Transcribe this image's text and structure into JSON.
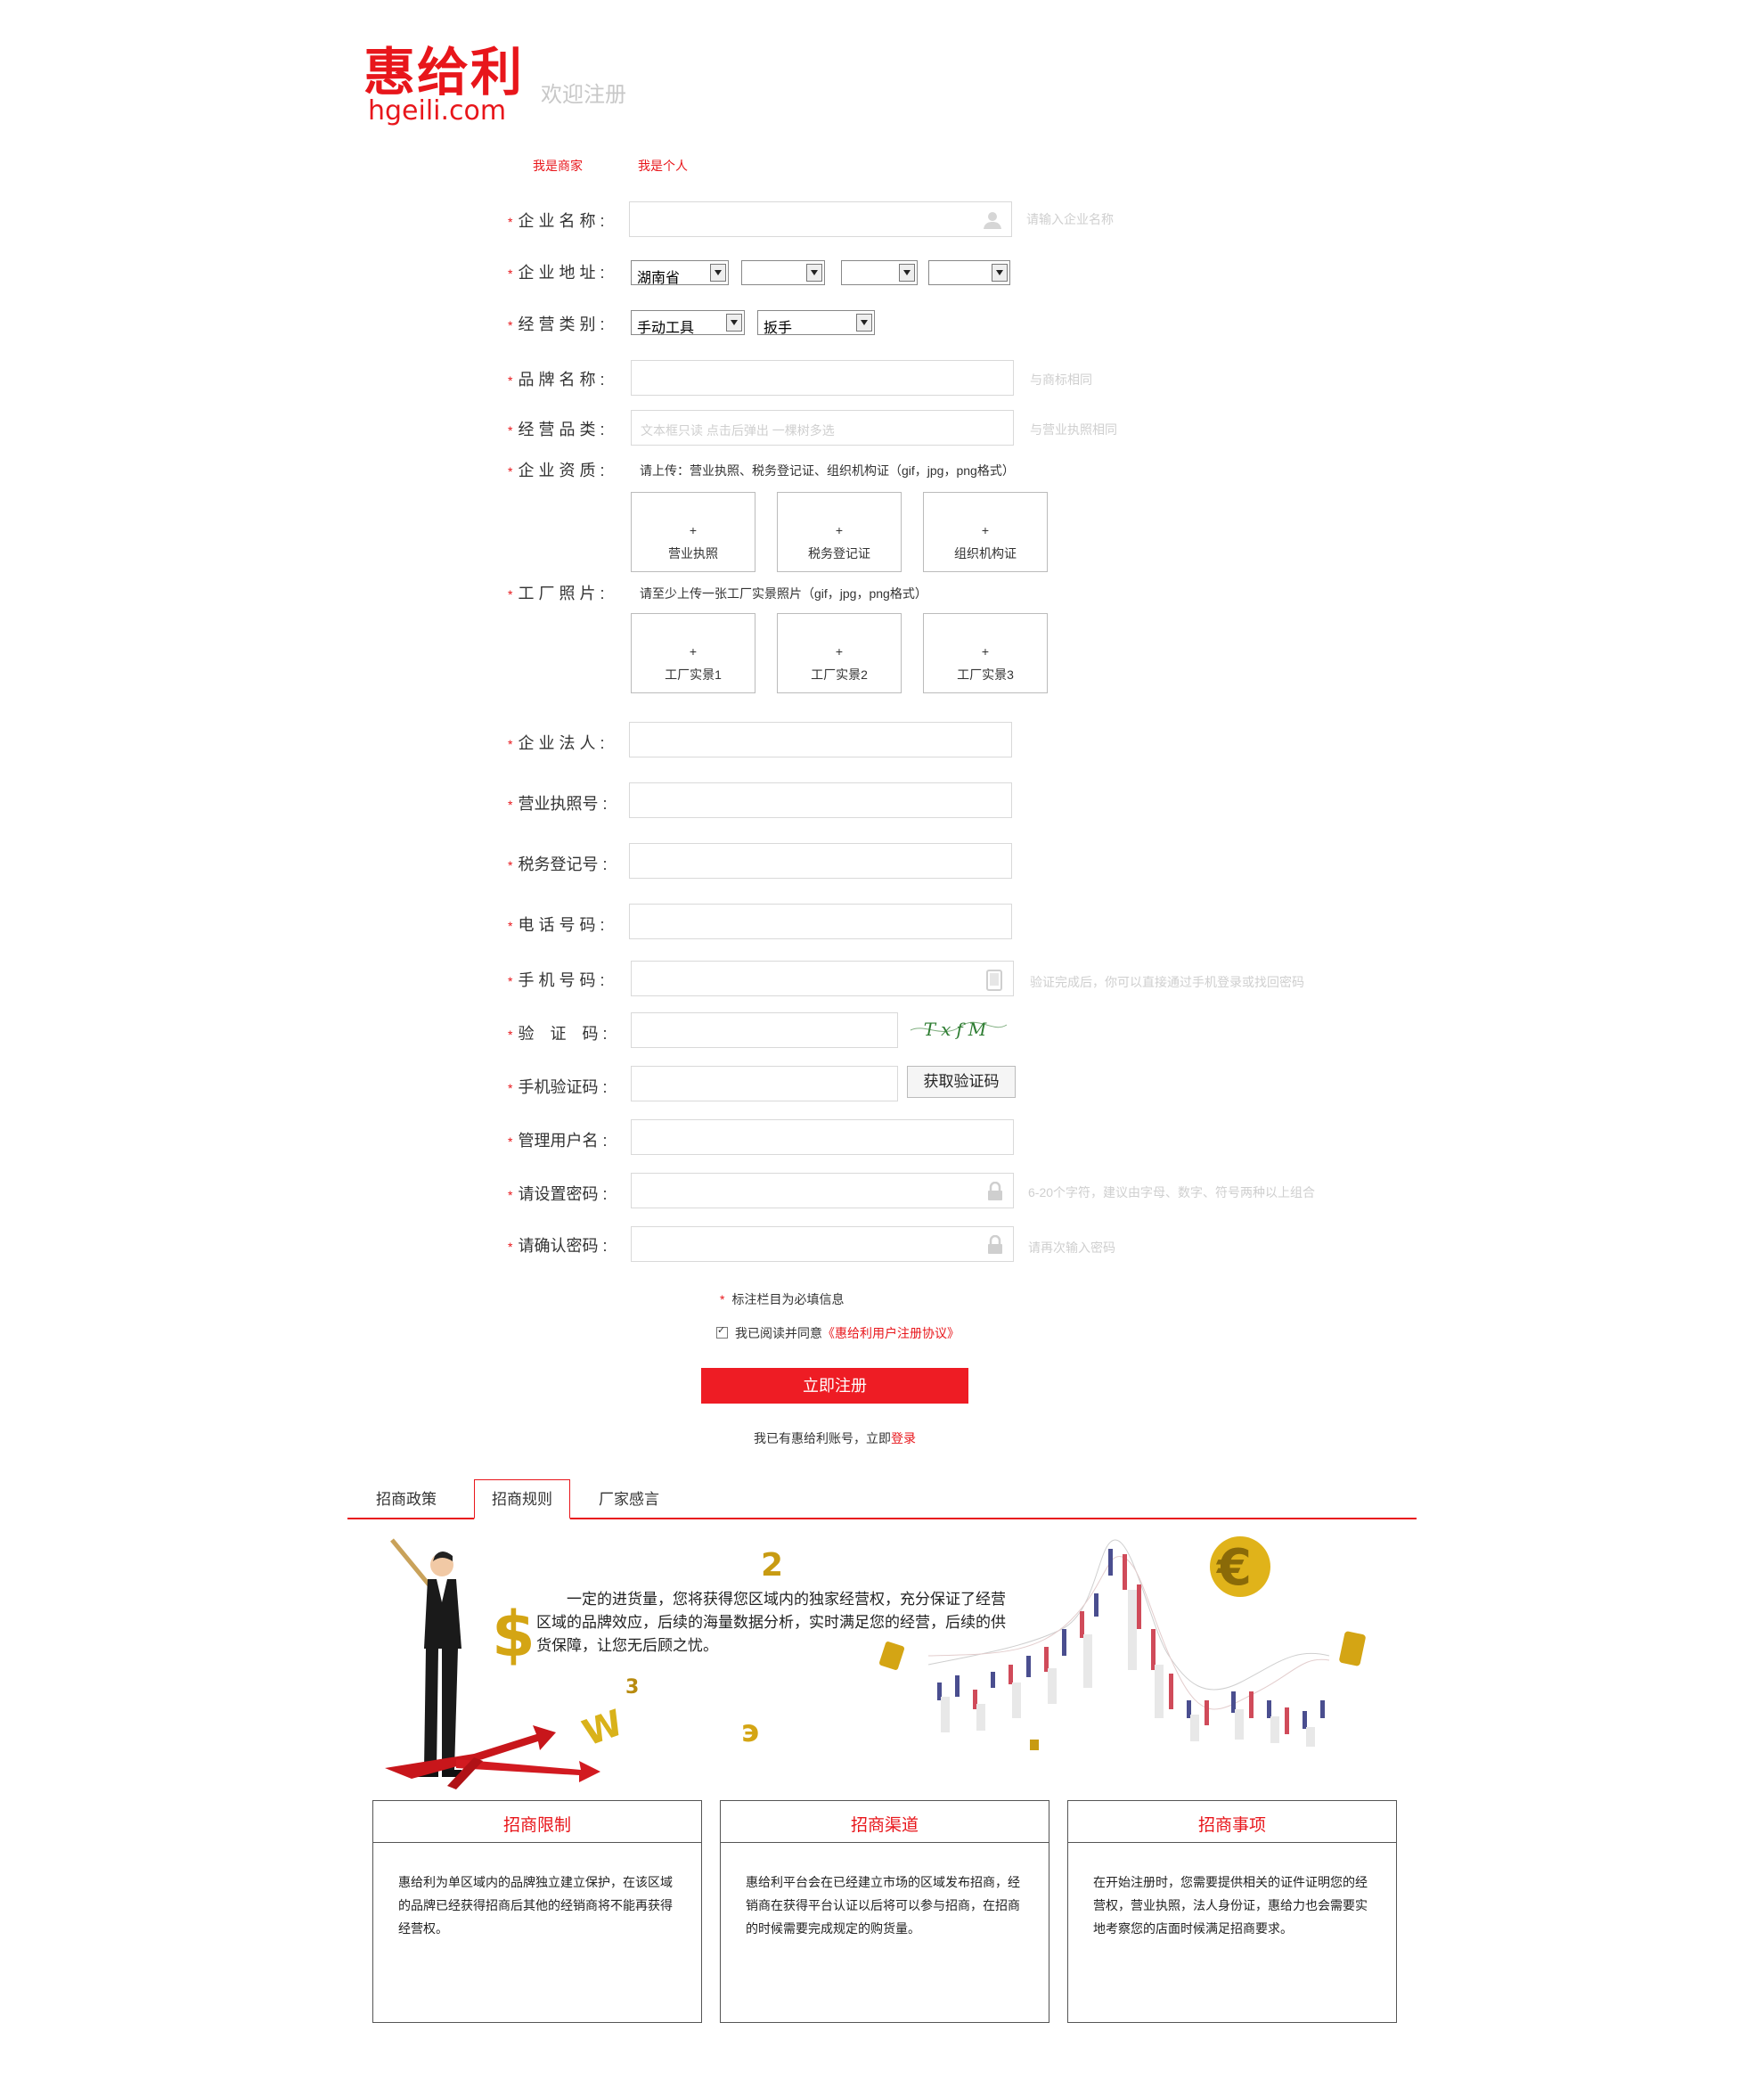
{
  "header": {
    "logo_cn": "惠给利",
    "logo_en": "hgeili.com",
    "welcome": "欢迎注册"
  },
  "reg_tabs": [
    "我是商家",
    "我是个人"
  ],
  "form": {
    "company_name": {
      "label": "企 业 名 称 :",
      "hint": "请输入企业名称"
    },
    "address": {
      "label": "企 业 地 址 :",
      "province": "湖南省",
      "city": "",
      "district": "",
      "street": ""
    },
    "category": {
      "label": "经 营 类 别 :",
      "main": "手动工具",
      "sub": "扳手"
    },
    "brand": {
      "label": "品 牌 名 称 :",
      "hint": "与商标相同"
    },
    "products": {
      "label": "经 营 品 类 :",
      "placeholder": "文本框只读 点击后弹出 一棵树多选",
      "hint": "与营业执照相同"
    },
    "qualification": {
      "label": "企 业 资 质 :",
      "note": "请上传：营业执照、税务登记证、组织机构证（gif，jpg，png格式）",
      "uploads": [
        "营业执照",
        "税务登记证",
        "组织机构证"
      ]
    },
    "factory": {
      "label": "工 厂 照 片 :",
      "note": "请至少上传一张工厂实景照片（gif，jpg，png格式）",
      "uploads": [
        "工厂实景1",
        "工厂实景2",
        "工厂实景3"
      ]
    },
    "upload_plus": "+",
    "legal_person": {
      "label": "企 业 法 人 :"
    },
    "license_no": {
      "label": "营业执照号 :"
    },
    "tax_no": {
      "label": "税务登记号 :"
    },
    "phone": {
      "label": "电 话 号 码 :"
    },
    "mobile": {
      "label": "手 机 号 码 :",
      "hint": "验证完成后，你可以直接通过手机登录或找回密码"
    },
    "captcha": {
      "label": "验　证　码 :",
      "code": "TxfM"
    },
    "sms_code": {
      "label": "手机验证码 :",
      "button": "获取验证码"
    },
    "username": {
      "label": "管理用户名 :"
    },
    "password": {
      "label": "请设置密码 :",
      "hint": "6-20个字符，建议由字母、数字、符号两种以上组合"
    },
    "password_confirm": {
      "label": "请确认密码 :",
      "hint": "请再次输入密码"
    },
    "required_mark": "*"
  },
  "required_note": "标注栏目为必填信息",
  "agree": {
    "text": "我已阅读并同意",
    "link": "《惠给利用户注册协议》"
  },
  "submit": "立即注册",
  "login": {
    "text": "我已有惠给利账号，立即",
    "link": "登录"
  },
  "info_tabs": {
    "items": [
      "招商政策",
      "招商规则",
      "厂家感言"
    ],
    "active": 1
  },
  "banner_text": "一定的进货量，您将获得您区域内的独家经营权，充分保证了经营区域的品牌效应，后续的海量数据分析，实时满足您的经营，后续的供货保障，让您无后顾之忧。",
  "cards": [
    {
      "title": "招商限制",
      "body": "惠给利为单区域内的品牌独立建立保护，在该区域的品牌已经获得招商后其他的经销商将不能再获得经营权。"
    },
    {
      "title": "招商渠道",
      "body": "惠给利平台会在已经建立市场的区域发布招商，经销商在获得平台认证以后将可以参与招商，在招商的时候需要完成规定的购货量。"
    },
    {
      "title": "招商事项",
      "body": "在开始注册时，您需要提供相关的证件证明您的经营权，营业执照，法人身份证，惠给力也会需要实地考察您的店面时候满足招商要求。"
    }
  ],
  "colors": {
    "brand_red": "#e8161b",
    "button_red": "#ee1c24",
    "hint_gray": "#cfcfcf"
  }
}
